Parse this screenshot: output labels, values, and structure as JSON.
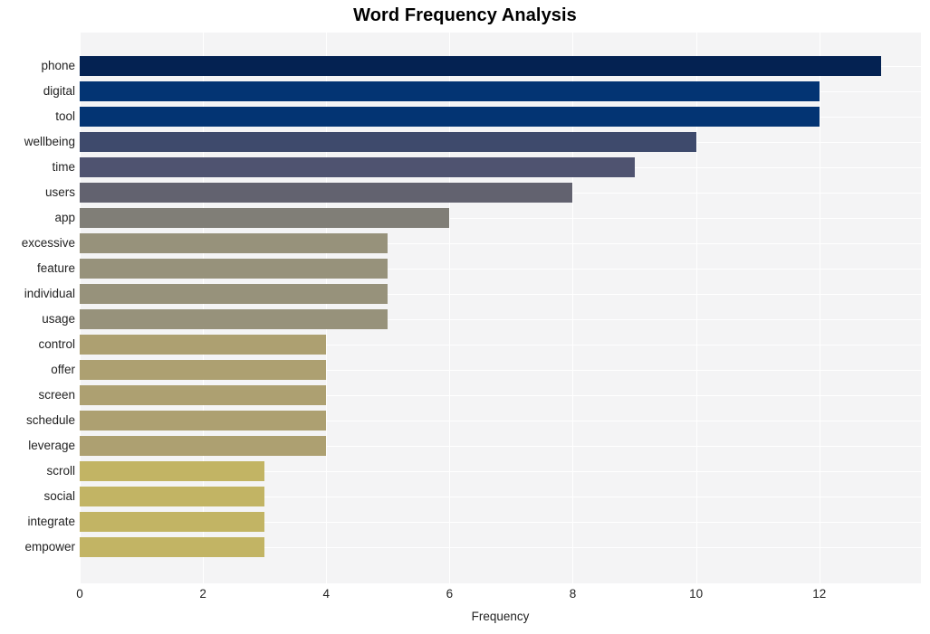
{
  "chart_data": {
    "type": "bar",
    "orientation": "horizontal",
    "title": "Word Frequency Analysis",
    "xlabel": "Frequency",
    "ylabel": "",
    "xlim": [
      0,
      13.65
    ],
    "xticks": [
      0,
      2,
      4,
      6,
      8,
      10,
      12
    ],
    "xtick_labels": [
      "0",
      "2",
      "4",
      "6",
      "8",
      "10",
      "12"
    ],
    "grid": true,
    "grid_axis": "both",
    "grid_color": "#ffffff",
    "plot_background": "#f4f4f5",
    "figure_background": "#ffffff",
    "legend": null,
    "categories": [
      "phone",
      "digital",
      "tool",
      "wellbeing",
      "time",
      "users",
      "app",
      "excessive",
      "feature",
      "individual",
      "usage",
      "control",
      "offer",
      "screen",
      "schedule",
      "leverage",
      "scroll",
      "social",
      "integrate",
      "empower"
    ],
    "values": [
      13,
      12,
      12,
      10,
      9,
      8,
      6,
      5,
      5,
      5,
      5,
      4,
      4,
      4,
      4,
      4,
      3,
      3,
      3,
      3
    ],
    "bar_colors": [
      "#042252",
      "#033473",
      "#033473",
      "#3e4a6c",
      "#4f5370",
      "#62626f",
      "#807e77",
      "#97927b",
      "#97927b",
      "#97927b",
      "#97927b",
      "#ada071",
      "#ada071",
      "#ada071",
      "#ada071",
      "#ada071",
      "#c2b464",
      "#c2b464",
      "#c2b464",
      "#c2b464"
    ]
  }
}
